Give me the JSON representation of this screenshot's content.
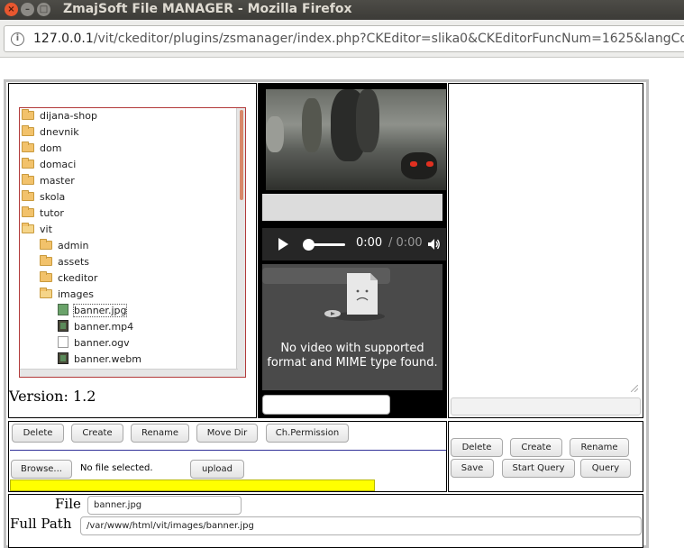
{
  "window": {
    "title": "ZmajSoft File MANAGER - Mozilla Firefox",
    "close": "×",
    "minimize": "–",
    "maximize": "□"
  },
  "browser": {
    "info_icon": "i",
    "url_host": "127.0.0.1",
    "url_path": "/vit/ckeditor/plugins/zsmanager/index.php?CKEditor=slika0&CKEditorFuncNum=1625&langCode"
  },
  "tree": {
    "items": [
      {
        "label": "dijana-shop",
        "type": "folder"
      },
      {
        "label": "dnevnik",
        "type": "folder"
      },
      {
        "label": "dom",
        "type": "folder"
      },
      {
        "label": "domaci",
        "type": "folder"
      },
      {
        "label": "master",
        "type": "folder"
      },
      {
        "label": "skola",
        "type": "folder"
      },
      {
        "label": "tutor",
        "type": "folder"
      },
      {
        "label": "vit",
        "type": "folder-open"
      },
      {
        "label": "admin",
        "type": "folder"
      },
      {
        "label": "assets",
        "type": "folder"
      },
      {
        "label": "ckeditor",
        "type": "folder"
      },
      {
        "label": "images",
        "type": "folder-open"
      },
      {
        "label": "banner.jpg",
        "type": "image",
        "selected": true
      },
      {
        "label": "banner.mp4",
        "type": "film"
      },
      {
        "label": "banner.ogv",
        "type": "blank"
      },
      {
        "label": "banner.webm",
        "type": "film"
      }
    ],
    "version": "Version: 1.2"
  },
  "preview": {
    "time_current": "0:00",
    "time_total": "/ 0:00",
    "no_video_message": "No video with supported format and MIME type found."
  },
  "file_actions": {
    "delete": "Delete",
    "create": "Create",
    "rename": "Rename",
    "move_dir": "Move Dir",
    "ch_permission": "Ch.Permission",
    "browse": "Browse...",
    "no_file": "No file selected.",
    "upload": "upload"
  },
  "db_actions": {
    "delete": "Delete",
    "create": "Create",
    "rename": "Rename",
    "save": "Save",
    "start_query": "Start Query",
    "query": "Query"
  },
  "path": {
    "file_label": "File",
    "file_value": "banner.jpg",
    "full_path_label": "Full Path",
    "full_path_value": "/var/www/html/vit/images/banner.jpg"
  },
  "colors": {
    "progress_bar": "#ffff00",
    "tree_border": "#b23a3a",
    "separator": "#333399"
  }
}
